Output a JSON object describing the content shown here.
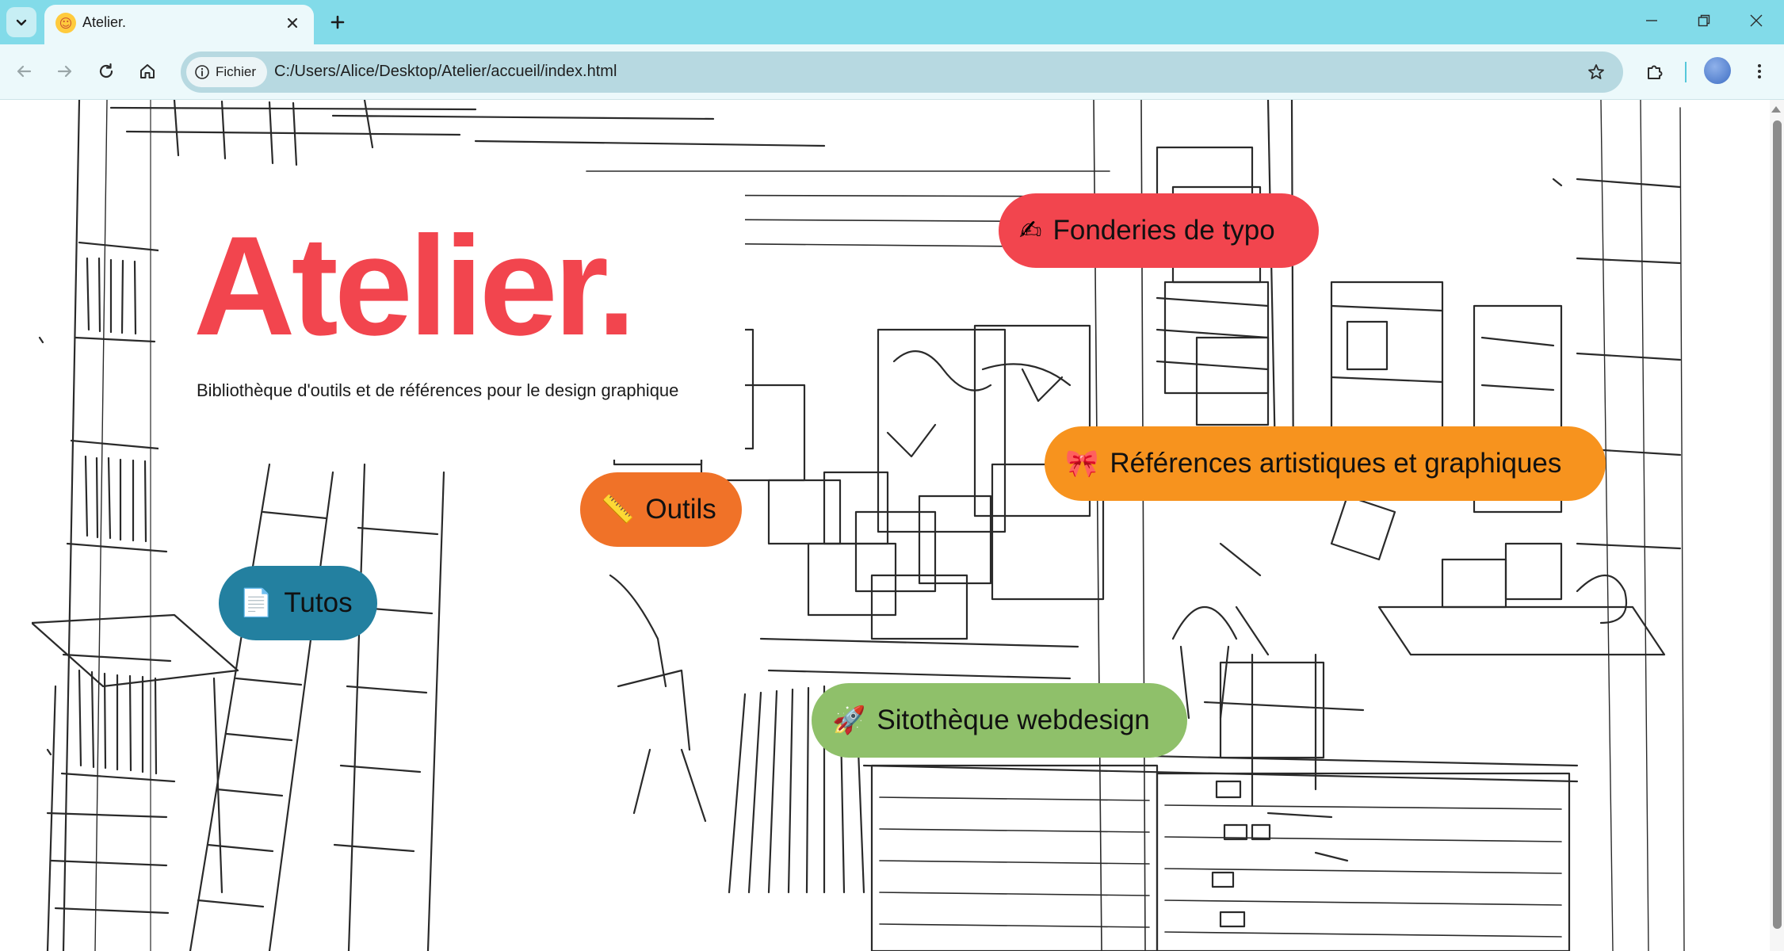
{
  "browser": {
    "tab_title": "Atelier.",
    "favicon_glyph": "☺",
    "site_chip_label": "Fichier",
    "url": "C:/Users/Alice/Desktop/Atelier/accueil/index.html",
    "colors": {
      "tabbar": "#82dbe9",
      "toolbar": "#ecf9fb",
      "omnibox": "#b7d9e1"
    }
  },
  "page": {
    "title": "Atelier.",
    "subtitle": "Bibliothèque d'outils et de références pour le design graphique",
    "title_color": "#f2454e",
    "links": [
      {
        "id": "fonderies",
        "emoji": "✍",
        "icon": "writing-hand-icon",
        "label": "Fonderies de typo",
        "color": "#f2454e"
      },
      {
        "id": "references",
        "emoji": "🎀",
        "icon": "ribbon-icon",
        "label": "Références artistiques et graphiques",
        "color": "#f7931e"
      },
      {
        "id": "outils",
        "emoji": "📏",
        "icon": "ruler-icon",
        "label": "Outils",
        "color": "#f07228"
      },
      {
        "id": "tutos",
        "emoji": "📄",
        "icon": "page-icon",
        "label": "Tutos",
        "color": "#2380a0"
      },
      {
        "id": "sito",
        "emoji": "🚀",
        "icon": "rocket-icon",
        "label": "Sitothèque webdesign",
        "color": "#8fc06a"
      }
    ]
  }
}
